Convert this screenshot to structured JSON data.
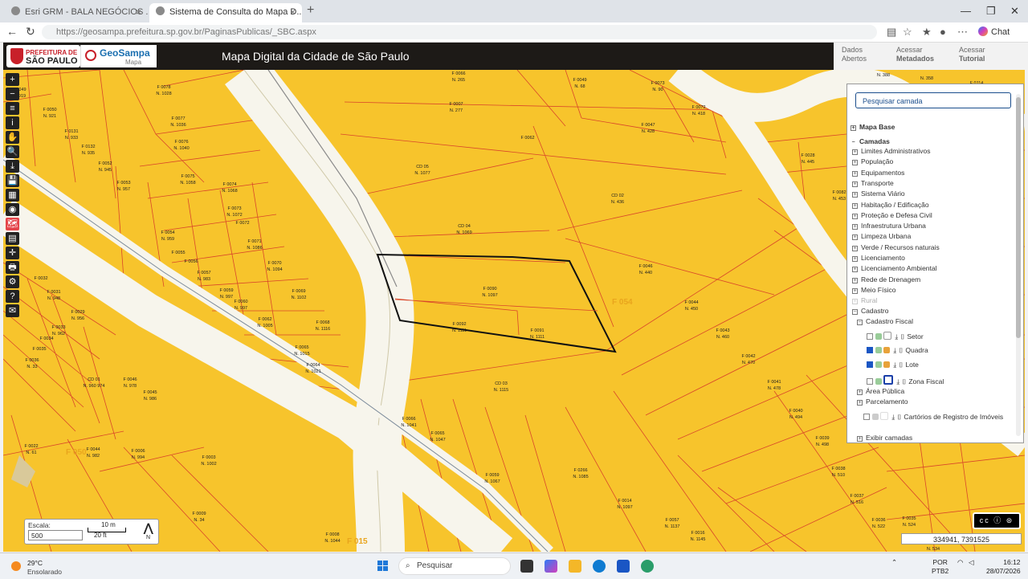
{
  "browser": {
    "tab1_title": "Esri GRM - BALA NEGÓCIOS ...",
    "tab2_title": "Sistema de Consulta do Mapa D...",
    "url": "https://geosampa.prefeitura.sp.gov.br/PaginasPublicas/_SBC.aspx",
    "chat_label": "Chat"
  },
  "header": {
    "pref_line1": "PREFEITURA DE",
    "pref_line2": "SÃO PAULO",
    "geo_line1": "GeoSampa",
    "geo_line2": "Mapa",
    "title": "Mapa Digital da Cidade de São Paulo",
    "btn1_l1": "Dados",
    "btn1_l2": "Abertos",
    "btn2_l1": "Acessar",
    "btn2_l2": "Metadados",
    "btn3_l1": "Acessar",
    "btn3_l2": "Tutorial"
  },
  "toolbar": [
    "+",
    "−",
    "≡",
    "i",
    "✋",
    "🔍",
    "⤓",
    "💾",
    "▦",
    "◉",
    "🗺",
    "▤",
    "✛",
    "🖶",
    "⚙",
    "?",
    "✉"
  ],
  "layers": {
    "search_placeholder": "Pesquisar camada",
    "mapa_base": "Mapa Base",
    "camadas": "Camadas",
    "items": [
      "Limites Administrativos",
      "População",
      "Equipamentos",
      "Transporte",
      "Sistema Viário",
      "Habitação / Edificação",
      "Proteção e Defesa Civil",
      "Infraestrutura Urbana",
      "Limpeza Urbana",
      "Verde / Recursos naturais",
      "Licenciamento",
      "Licenciamento Ambiental",
      "Rede de Drenagem",
      "Meio Físico"
    ],
    "rural": "Rural",
    "cadastro": "Cadastro",
    "cadastro_fiscal": "Cadastro Fiscal",
    "setor": "Setor",
    "quadra": "Quadra",
    "lote": "Lote",
    "zona_fiscal": "Zona Fiscal",
    "area_publica": "Área Pública",
    "parcelamento": "Parcelamento",
    "cartorios": "Cartórios de Registro de Imóveis",
    "exibir": "Exibir camadas"
  },
  "map": {
    "big_labels": [
      "F 054",
      "F 015",
      "F 050"
    ],
    "parcel_labels": [
      [
        "F 0049",
        "N. 919"
      ],
      [
        "F 0050",
        "N. 921"
      ],
      [
        "F 0078",
        "N. 1028"
      ],
      [
        "F 0131",
        "N. 933"
      ],
      [
        "F 0077",
        "N. 1036"
      ],
      [
        "F 0132",
        "N. 935"
      ],
      [
        "F 0076",
        "N. 1040"
      ],
      [
        "F 0052",
        "N. 945"
      ],
      [
        "F 0075",
        "N. 1058"
      ],
      [
        "F 0053",
        "N. 957"
      ],
      [
        "F 0074",
        "N. 1068"
      ],
      [
        "F 0073",
        "N. 1072"
      ],
      [
        "F 0072",
        ""
      ],
      [
        "F 0054",
        "N. 959"
      ],
      [
        "F 0071",
        "N. 1086"
      ],
      [
        "F 0055",
        ""
      ],
      [
        "F 0056",
        ""
      ],
      [
        "F 0057",
        "N. 983"
      ],
      [
        "F 0070",
        "N. 1094"
      ],
      [
        "F 0059",
        "N. 997"
      ],
      [
        "F 0060",
        "N. 997"
      ],
      [
        "F 0069",
        "N. 1102"
      ],
      [
        "F 0062",
        "N. 1005"
      ],
      [
        "F 0068",
        "N. 1116"
      ],
      [
        "F 0032",
        ""
      ],
      [
        "F 0031",
        "N. 948"
      ],
      [
        "F 0029",
        "N. 956"
      ],
      [
        "F 0033",
        "N. 962"
      ],
      [
        "F 0034",
        ""
      ],
      [
        "F 0065",
        "N. 1015"
      ],
      [
        "F 0035",
        ""
      ],
      [
        "F 0036",
        "N. 33"
      ],
      [
        "F 0064",
        "N. 1021"
      ],
      [
        "CD 01",
        "N. 960 974"
      ],
      [
        "F 0046",
        "N. 978"
      ],
      [
        "F 0045",
        "N. 986"
      ],
      [
        "F 0022",
        "N. 61"
      ],
      [
        "F 0044",
        "N. 982"
      ],
      [
        "F 0006",
        "N. 994"
      ],
      [
        "F 0003",
        "N. 1002"
      ],
      [
        "F 0009",
        "N. 34"
      ],
      [
        "F 0008",
        "N. 1044"
      ],
      [
        "F 0066",
        "N. 265"
      ],
      [
        "F 0007",
        "N. 277"
      ],
      [
        "F 0062",
        ""
      ],
      [
        "CD 05",
        "N. 1077"
      ],
      [
        "CD 04",
        "N. 1069"
      ],
      [
        "F 0090",
        "N. 1097"
      ],
      [
        "F 0092",
        "N. 1111"
      ],
      [
        "F 0091",
        "N. 1111"
      ],
      [
        "CD 03",
        "N. 1115"
      ],
      [
        "F 0066",
        "N. 1041"
      ],
      [
        "F 0065",
        "N. 1047"
      ],
      [
        "F 0059",
        "N. 1067"
      ],
      [
        "F 0266",
        "N. 1085"
      ],
      [
        "F 0014",
        "N. 1097"
      ],
      [
        "F 0057",
        "N. 1137"
      ],
      [
        "F 0016",
        "N. 1145"
      ],
      [
        "F 0049",
        "N. 68"
      ],
      [
        "F 0073",
        "N. 90"
      ],
      [
        "F 0072",
        "N. 418"
      ],
      [
        "F 0047",
        "N. 428"
      ],
      [
        "CD 02",
        "N. 436"
      ],
      [
        "F 0046",
        "N. 440"
      ],
      [
        "F 0044",
        "N. 450"
      ],
      [
        "F 0043",
        "N. 460"
      ],
      [
        "F 0042",
        "N. 470"
      ],
      [
        "F 0041",
        "N. 478"
      ],
      [
        "F 0040",
        "N. 494"
      ],
      [
        "F 0039",
        "N. 498"
      ],
      [
        "F 0038",
        "N. 510"
      ],
      [
        "F 0037",
        "N. 516"
      ],
      [
        "F 0036",
        "N. 522"
      ],
      [
        "F 0035",
        "N. 524"
      ],
      [
        "F 0034",
        "N. 534"
      ],
      [
        "F 0033",
        ""
      ],
      [
        "F 0028",
        "N. 445"
      ],
      [
        "F 0082",
        "N. 453"
      ],
      [
        "N. 388",
        ""
      ],
      [
        "N. 358",
        ""
      ],
      [
        "F 0114",
        ""
      ]
    ]
  },
  "scale": {
    "label": "Escala:",
    "value": "500",
    "bar1": "10 m",
    "bar2": "20 ft",
    "north": "N"
  },
  "coords": "334941, 7391525",
  "taskbar": {
    "temp": "29°C",
    "weather": "Ensolarado",
    "search": "Pesquisar",
    "lang1": "POR",
    "lang2": "PTB2",
    "time": "16:12",
    "date": "28/07/2026"
  }
}
